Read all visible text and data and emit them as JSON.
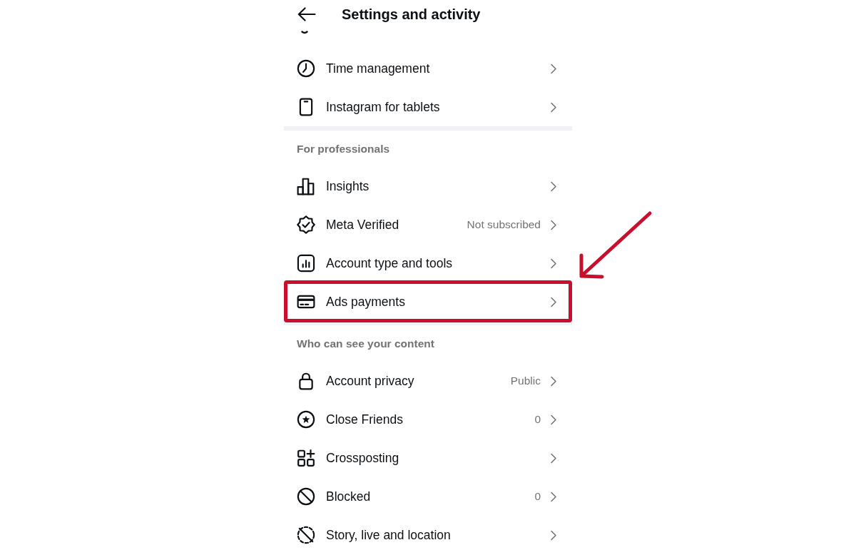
{
  "header": {
    "title": "Settings and activity"
  },
  "sections": [
    {
      "items": [
        {
          "label": "Time management",
          "highlighted": false
        },
        {
          "label": "Instagram for tablets",
          "highlighted": false
        }
      ]
    },
    {
      "title": "For professionals",
      "items": [
        {
          "label": "Insights",
          "highlighted": false
        },
        {
          "label": "Meta Verified",
          "value": "Not subscribed",
          "highlighted": false
        },
        {
          "label": "Account type and tools",
          "highlighted": false
        },
        {
          "label": "Ads payments",
          "highlighted": true
        }
      ]
    },
    {
      "title": "Who can see your content",
      "items": [
        {
          "label": "Account privacy",
          "value": "Public",
          "highlighted": false
        },
        {
          "label": "Close Friends",
          "value": "0",
          "highlighted": false
        },
        {
          "label": "Crossposting",
          "highlighted": false
        },
        {
          "label": "Blocked",
          "value": "0",
          "highlighted": false
        },
        {
          "label": "Story, live and location",
          "highlighted": false
        }
      ]
    }
  ]
}
